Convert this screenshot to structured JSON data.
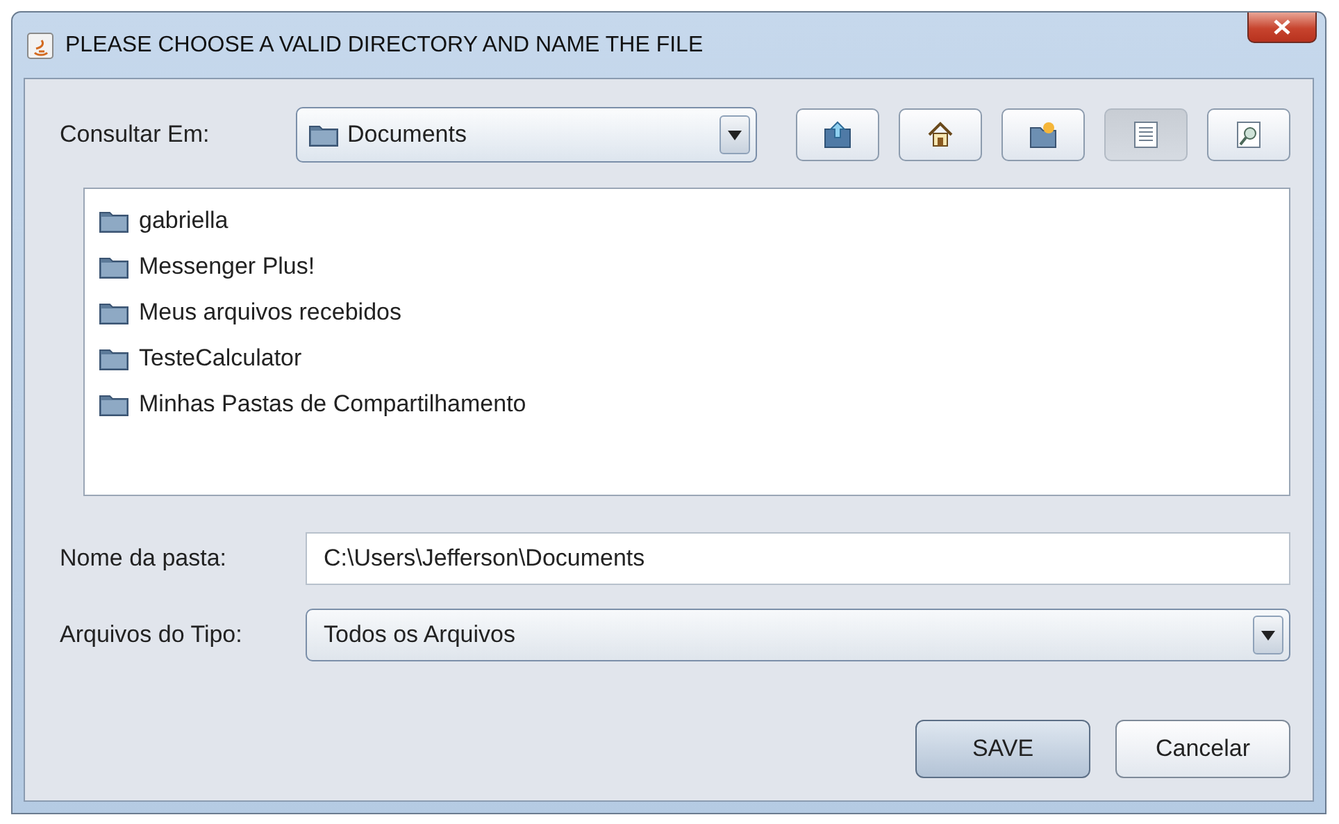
{
  "window": {
    "title": "PLEASE CHOOSE A VALID DIRECTORY AND NAME THE FILE"
  },
  "look_in": {
    "label": "Consultar Em:",
    "value": "Documents"
  },
  "toolbar": [
    {
      "kind": "up",
      "selected": false
    },
    {
      "kind": "home",
      "selected": false
    },
    {
      "kind": "new-folder",
      "selected": false
    },
    {
      "kind": "list",
      "selected": true
    },
    {
      "kind": "details",
      "selected": false
    }
  ],
  "files": [
    {
      "name": "gabriella"
    },
    {
      "name": "Messenger Plus!"
    },
    {
      "name": "Meus arquivos recebidos"
    },
    {
      "name": "TesteCalculator"
    },
    {
      "name": "Minhas Pastas de Compartilhamento"
    }
  ],
  "folder_name": {
    "label": "Nome da pasta:",
    "value": "C:\\Users\\Jefferson\\Documents"
  },
  "file_type": {
    "label": "Arquivos do Tipo:",
    "value": "Todos os Arquivos"
  },
  "buttons": [
    {
      "kind": "primary",
      "label": "SAVE"
    },
    {
      "kind": "secondary",
      "label": "Cancelar"
    }
  ]
}
